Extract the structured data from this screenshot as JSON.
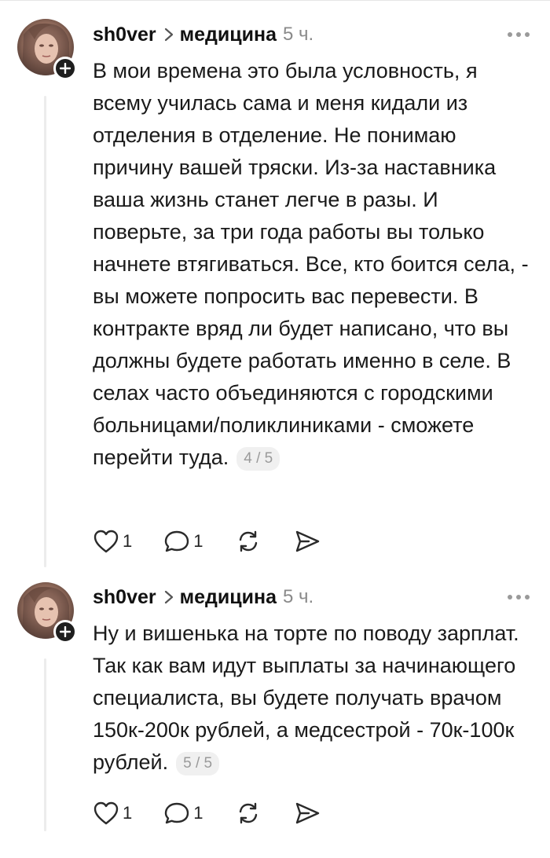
{
  "comments": [
    {
      "author": "sh0ver",
      "community": "медицина",
      "time": "5 ч.",
      "text": "В мои времена это была условность, я всему училась сама и меня кидали из отделения в отделение. Не понимаю причину вашей тряски. Из-за наставника ваша жизнь станет легче в разы. И поверьте, за три года работы вы только начнете втягиваться. Все, кто боится села, - вы можете попросить вас перевести. В контракте вряд ли будет написано, что вы должны будете работать именно в селе. В селах часто объединяются с городскими больницами/поликлиниками - сможете перейти туда.",
      "pager": "4 / 5",
      "likes": "1",
      "replies": "1"
    },
    {
      "author": "sh0ver",
      "community": "медицина",
      "time": "5 ч.",
      "text": "Ну и вишенька на торте по поводу зарплат. Так как вам идут выплаты за начинающего специалиста, вы будете получать врачом 150к-200к рублей, а медсестрой - 70к-100к рублей.",
      "pager": "5 / 5",
      "likes": "1",
      "replies": "1"
    }
  ],
  "icons": {
    "like": "heart-icon",
    "reply": "comment-icon",
    "repost": "repost-icon",
    "share": "send-icon",
    "follow": "plus-icon",
    "more": "more-icon",
    "separator": "chevron-right-icon"
  },
  "colors": {
    "text": "#1a1a1a",
    "muted": "#8a8a8a",
    "thread_line": "#ececec",
    "plus_badge": "#1e1e1e"
  }
}
